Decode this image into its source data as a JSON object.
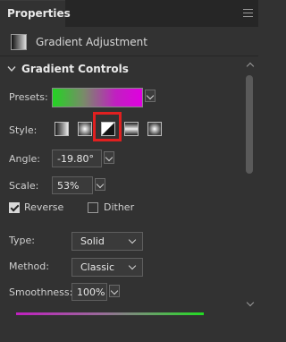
{
  "panel": {
    "tab_title": "Properties",
    "menu_icon": "hamburger-menu-icon"
  },
  "adjustment": {
    "icon": "gradient-adjustment-icon",
    "label": "Gradient Adjustment"
  },
  "section": {
    "title": "Gradient Controls",
    "collapse_icon": "chevron-down-icon"
  },
  "presets": {
    "label": "Presets:",
    "gradient_colors": [
      "#23d423",
      "#e000e0"
    ]
  },
  "style": {
    "label": "Style:",
    "options": [
      "linear",
      "radial",
      "angle",
      "reflected",
      "diamond"
    ],
    "selected": "angle",
    "highlight_color": "#e02020"
  },
  "angle": {
    "label": "Angle:",
    "value": "-19.80°"
  },
  "scale": {
    "label": "Scale:",
    "value": "53%"
  },
  "reverse": {
    "label": "Reverse",
    "checked": true
  },
  "dither": {
    "label": "Dither",
    "checked": false
  },
  "type": {
    "label": "Type:",
    "value": "Solid"
  },
  "method": {
    "label": "Method:",
    "value": "Classic"
  },
  "smoothness": {
    "label": "Smoothness:",
    "value": "100%"
  }
}
